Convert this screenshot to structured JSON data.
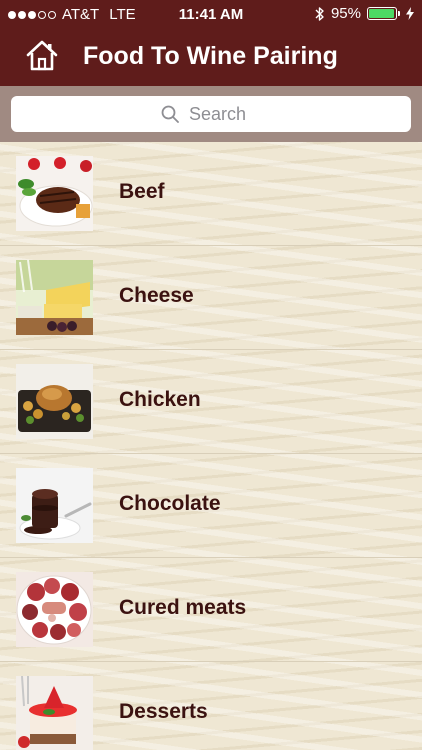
{
  "status_bar": {
    "carrier": "AT&T",
    "network": "LTE",
    "time": "11:41 AM",
    "battery_percent": "95%",
    "battery_level": 0.95,
    "signal_bars_filled": 3,
    "signal_bars_total": 5
  },
  "nav": {
    "title": "Food To Wine Pairing"
  },
  "search": {
    "placeholder": "Search",
    "value": ""
  },
  "categories": [
    {
      "label": "Beef"
    },
    {
      "label": "Cheese"
    },
    {
      "label": "Chicken"
    },
    {
      "label": "Chocolate"
    },
    {
      "label": "Cured meats"
    },
    {
      "label": "Desserts"
    }
  ],
  "colors": {
    "header": "#5f1c1b",
    "search_bar_bg": "#a08a82",
    "list_text": "#3b1210",
    "battery_fill": "#4cd964"
  }
}
